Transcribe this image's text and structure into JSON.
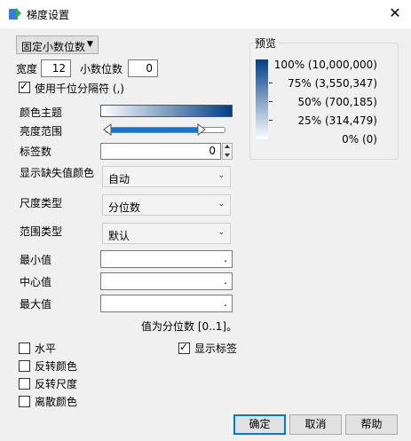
{
  "window": {
    "title": "梯度设置",
    "close_glyph": "✕"
  },
  "format_dropdown": {
    "value": "固定小数位数",
    "arrow": "▼"
  },
  "width": {
    "label": "宽度",
    "value": "12"
  },
  "decimals": {
    "label": "小数位数",
    "value": "0"
  },
  "thousands_sep": {
    "label": "使用千位分隔符 (,)",
    "checked": true
  },
  "color_theme": {
    "label": "颜色主题",
    "gradient_start": "#ffffff",
    "gradient_end": "#003e88"
  },
  "brightness": {
    "label": "亮度范围"
  },
  "tick_count": {
    "label": "标签数",
    "value": "0"
  },
  "missing_color": {
    "label": "显示缺失值颜色",
    "value": "自动"
  },
  "scale_type": {
    "label": "尺度类型",
    "value": "分位数"
  },
  "range_type": {
    "label": "范围类型",
    "value": "默认"
  },
  "min_value": {
    "label": "最小值",
    "value": "."
  },
  "center_value": {
    "label": "中心值",
    "value": "."
  },
  "max_value": {
    "label": "最大值",
    "value": "."
  },
  "hint": "值为分位数 [0..1]。",
  "options": {
    "horizontal": {
      "label": "水平",
      "checked": false
    },
    "reverse_color": {
      "label": "反转颜色",
      "checked": false
    },
    "reverse_scale": {
      "label": "反转尺度",
      "checked": false
    },
    "discrete_color": {
      "label": "离散颜色",
      "checked": false
    },
    "show_labels": {
      "label": "显示标签",
      "checked": true
    }
  },
  "preview": {
    "title": "预览",
    "labels": [
      "100% (10,000,000)",
      "75% (3,550,347)",
      "50% (700,185)",
      "25% (314,479)",
      "0% (0)"
    ]
  },
  "buttons": {
    "ok": "确定",
    "cancel": "取消",
    "help": "帮助"
  }
}
